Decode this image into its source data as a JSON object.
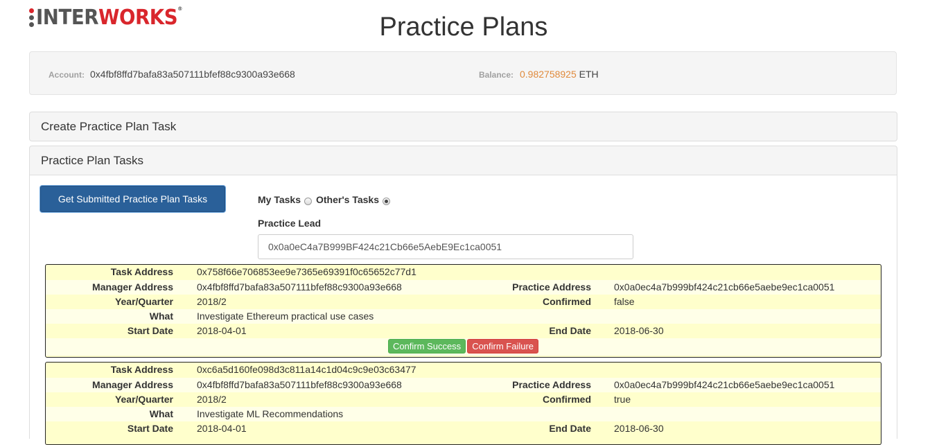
{
  "logo": {
    "text_a": "INTER",
    "text_b": "WORKS",
    "reg": "®"
  },
  "page_title": "Practice Plans",
  "account": {
    "label": "Account:",
    "value": "0x4fbf8ffd7bafa83a507111bfef88c9300a93e668"
  },
  "balance": {
    "label": "Balance:",
    "amount": "0.982758925",
    "unit": "ETH"
  },
  "panels": {
    "create": "Create Practice Plan Task",
    "tasks": "Practice Plan Tasks"
  },
  "get_button": "Get Submitted Practice Plan Tasks",
  "radios": {
    "my": "My Tasks",
    "others": "Other's Tasks",
    "selected": "others"
  },
  "lead": {
    "label": "Practice Lead",
    "value": "0x0a0eC4a7B999BF424c21Cb66e5AebE9Ec1ca0051"
  },
  "labels": {
    "task_address": "Task Address",
    "manager_address": "Manager Address",
    "practice_address": "Practice Address",
    "year_quarter": "Year/Quarter",
    "confirmed": "Confirmed",
    "what": "What",
    "start_date": "Start Date",
    "end_date": "End Date",
    "confirm_success": "Confirm Success",
    "confirm_failure": "Confirm Failure"
  },
  "tasks": [
    {
      "task_address": "0x758f66e706853ee9e7365e69391f0c65652c77d1",
      "manager_address": "0x4fbf8ffd7bafa83a507111bfef88c9300a93e668",
      "practice_address": "0x0a0ec4a7b999bf424c21cb66e5aebe9ec1ca0051",
      "year_quarter": "2018/2",
      "confirmed": "false",
      "what": "Investigate Ethereum practical use cases",
      "start_date": "2018-04-01",
      "end_date": "2018-06-30"
    },
    {
      "task_address": "0xc6a5d160fe098d3c811a14c1d04c9c9e03c63477",
      "manager_address": "0x4fbf8ffd7bafa83a507111bfef88c9300a93e668",
      "practice_address": "0x0a0ec4a7b999bf424c21cb66e5aebe9ec1ca0051",
      "year_quarter": "2018/2",
      "confirmed": "true",
      "what": "Investigate ML Recommendations",
      "start_date": "2018-04-01",
      "end_date": "2018-06-30"
    }
  ]
}
